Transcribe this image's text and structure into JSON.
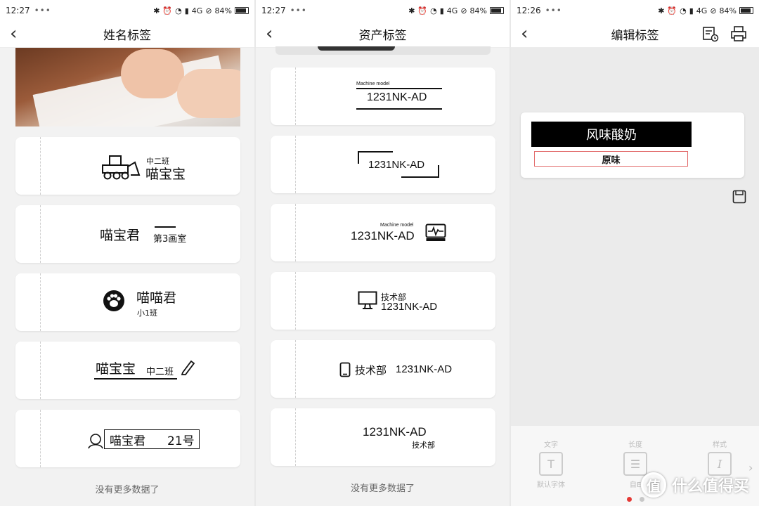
{
  "screens": [
    {
      "status": {
        "time": "12:27",
        "dots": "•••",
        "network": "4G",
        "battery": "84%"
      },
      "title": "姓名标签",
      "cards": {
        "c1": {
          "top": "中二班",
          "main": "喵宝宝"
        },
        "c2": {
          "main": "喵宝君",
          "sub": "第3画室"
        },
        "c3": {
          "main": "喵喵君",
          "sub": "小1班"
        },
        "c4": {
          "main": "喵宝宝",
          "sub": "中二班"
        },
        "c5": {
          "main": "喵宝君",
          "num": "21号"
        }
      },
      "footer": "没有更多数据了"
    },
    {
      "status": {
        "time": "12:27",
        "dots": "•••",
        "network": "4G",
        "battery": "84%"
      },
      "title": "资产标签",
      "cards": {
        "c1": {
          "caption": "Machine model",
          "code": "1231NK-AD"
        },
        "c2": {
          "code": "1231NK-AD"
        },
        "c3": {
          "caption": "Machine model",
          "code": "1231NK-AD"
        },
        "c4": {
          "dept": "技术部",
          "code": "1231NK-AD"
        },
        "c5": {
          "dept": "技术部",
          "code": "1231NK-AD"
        },
        "c6": {
          "code": "1231NK-AD",
          "dept": "技术部"
        }
      },
      "footer": "没有更多数据了"
    },
    {
      "status": {
        "time": "12:26",
        "dots": "•••",
        "network": "4G",
        "battery": "84%"
      },
      "title": "编辑标签",
      "label": {
        "line1": "风味酸奶",
        "line2": "原味"
      },
      "tools": {
        "text": {
          "cap": "文字",
          "sub": "默认字体"
        },
        "length": {
          "cap": "长度",
          "sub": "自E"
        },
        "style": {
          "cap": "样式"
        }
      }
    }
  ],
  "watermark": "什么值得买",
  "colors": {
    "accent_red": "#e53935",
    "label_border": "#e26a6a",
    "page_bg": "#f2f2f2"
  },
  "icons": [
    "back-chevron-icon",
    "bulldozer-icon",
    "paw-icon",
    "pencil-icon",
    "person-face-icon",
    "monitor-pulse-icon",
    "desktop-computer-icon",
    "phone-icon",
    "history-icon",
    "printer-icon",
    "save-icon"
  ]
}
